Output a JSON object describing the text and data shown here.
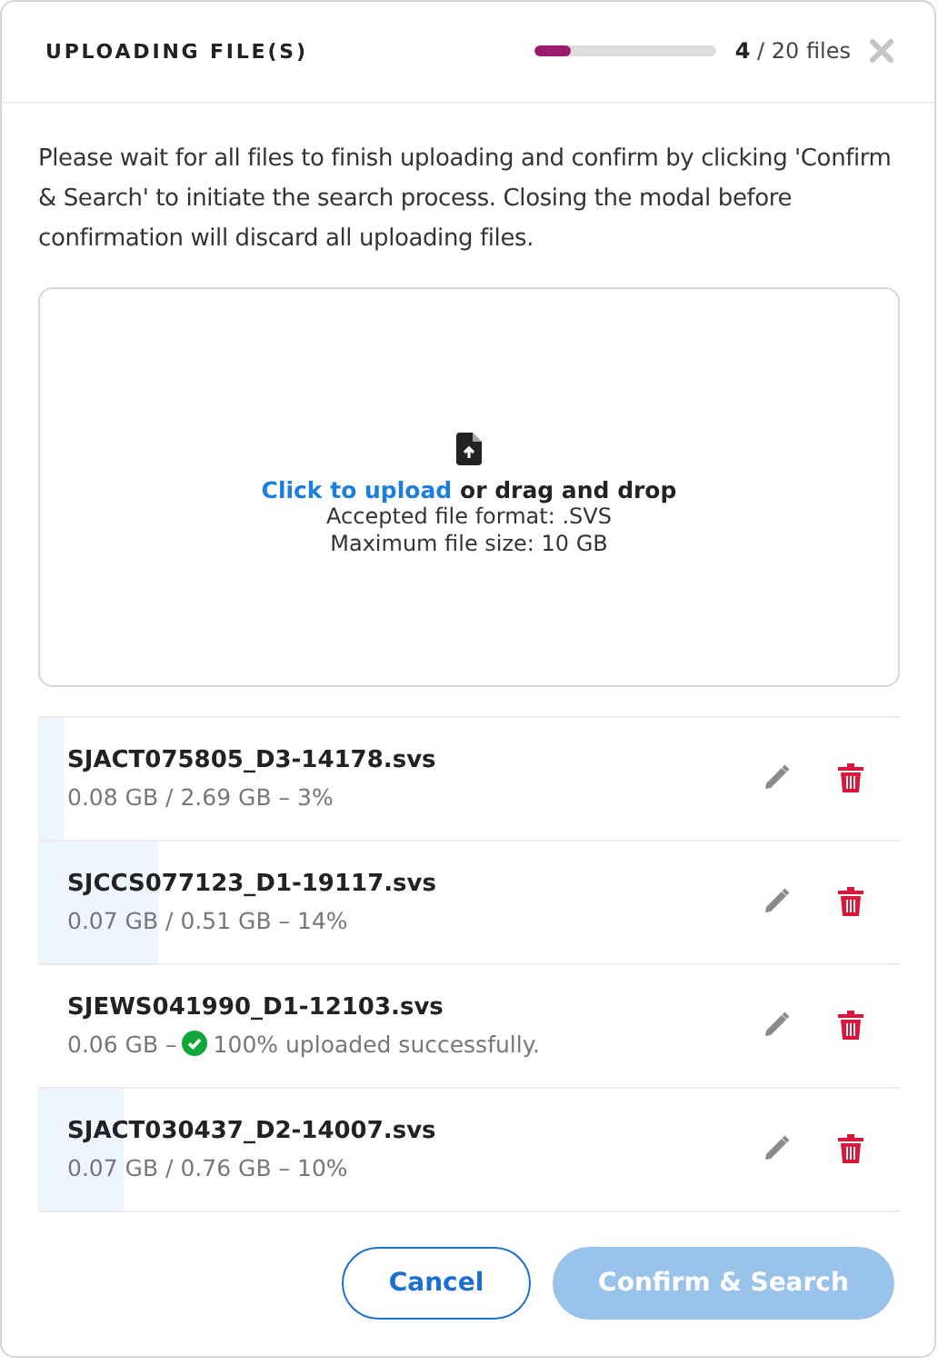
{
  "header": {
    "title": "UPLOADING FILE(S)",
    "progress": {
      "level": 0.2
    },
    "count_done": "4",
    "count_total": "/ 20 files"
  },
  "instructions": "Please wait for all files to finish uploading and confirm by clicking 'Confirm & Search' to initiate the search process. Closing the modal before confirmation will discard all uploading files.",
  "dropzone": {
    "link": "Click to upload",
    "text": "or drag and drop",
    "format": "Accepted file format: .SVS",
    "max_size": "Maximum file size: 10 GB"
  },
  "files": [
    {
      "kind": "uploading",
      "name": "SJACT075805_D3-14178.svs",
      "detail": "0.08 GB / 2.69 GB – 3%",
      "level": 0.03
    },
    {
      "kind": "uploading",
      "name": "SJCCS077123_D1-19117.svs",
      "detail": "0.07 GB / 0.51 GB – 14%",
      "level": 0.14
    },
    {
      "kind": "complete",
      "name": "SJEWS041990_D1-12103.svs",
      "detail": "0.06 GB –",
      "status": "100% uploaded successfully."
    },
    {
      "kind": "uploading",
      "name": "SJACT030437_D2-14007.svs",
      "detail": "0.07 GB / 0.76 GB – 10%",
      "level": 0.1
    }
  ],
  "buttons": {
    "cancel": {
      "label": "Cancel"
    },
    "confirm": {
      "label": "Confirm & Search",
      "disabled": true
    }
  }
}
